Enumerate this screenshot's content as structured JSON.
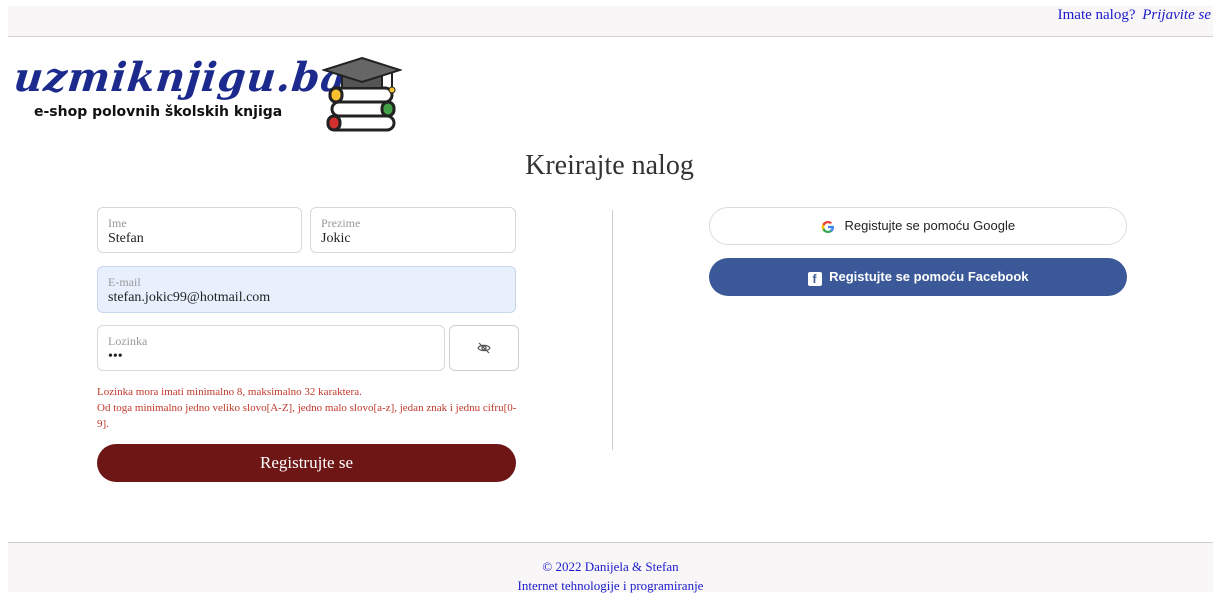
{
  "header": {
    "prompt": "Imate nalog?",
    "login_link": "Prijavite se"
  },
  "logo": {
    "brand": "uzmiknjigu.ba",
    "tagline": "e-shop polovnih školskih knjiga"
  },
  "page": {
    "title": "Kreirajte nalog"
  },
  "form": {
    "first_name": {
      "label": "Ime",
      "value": "Stefan"
    },
    "last_name": {
      "label": "Prezime",
      "value": "Jokic"
    },
    "email": {
      "label": "E-mail",
      "value": "stefan.jokic99@hotmail.com"
    },
    "password": {
      "label": "Lozinka",
      "value": "•••"
    },
    "error_line1": "Lozinka mora imati minimalno 8, maksimalno 32 karaktera.",
    "error_line2": "Od toga minimalno jedno veliko slovo[A-Z], jedno malo slovo[a-z], jedan znak i jednu cifru[0-9].",
    "submit_label": "Registrujte se"
  },
  "social": {
    "google_label": "Registujte se pomoću Google",
    "facebook_label": "Registujte se pomoću Facebook",
    "facebook_color": "#3b5998"
  },
  "footer": {
    "copyright": "© 2022 Danijela & Stefan",
    "course": "Internet tehnologije i programiranje"
  },
  "colors": {
    "accent": "#6e1616",
    "link": "#1a1acc",
    "error": "#c0392b",
    "autofill_bg": "#e8f0fe"
  }
}
